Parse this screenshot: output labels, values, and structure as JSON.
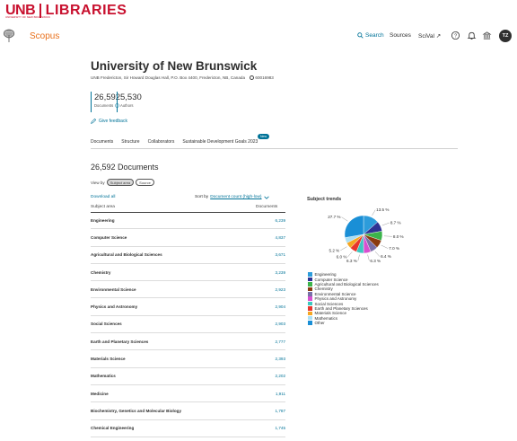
{
  "unb": {
    "mark": "UNB",
    "libraries": "LIBRARIES",
    "sub": "UNIVERSITY OF NEW BRUNSWICK"
  },
  "header": {
    "brand": "Scopus",
    "search_label": "Search",
    "sources_label": "Sources",
    "scival_label": "SciVal ↗",
    "avatar_initials": "TZ",
    "icons": [
      "search-icon",
      "help-icon",
      "bell-icon",
      "institution-icon"
    ]
  },
  "institution": {
    "name": "University of New Brunswick",
    "address": "UNB Fredericton, Sir Howard Douglas Hall, P.O. Box 4400, Fredericton, NB, Canada",
    "id": "60016983",
    "documents_count": "26,592",
    "documents_label": "Documents",
    "authors_count": "5,530",
    "authors_label": "Authors",
    "feedback_label": "Give feedback"
  },
  "tabs": [
    {
      "label": "Documents",
      "active": true
    },
    {
      "label": "Structure",
      "active": false
    },
    {
      "label": "Collaborators",
      "active": false
    },
    {
      "label": "Sustainable Development Goals 2023",
      "active": false
    }
  ],
  "new_badge": "New",
  "documents": {
    "heading": "26,592 Documents",
    "view_by_label": "View by",
    "view_options": [
      {
        "label": "Subject area",
        "selected": true
      },
      {
        "label": "Source",
        "selected": false
      }
    ],
    "download_label": "Download all",
    "sort_label": "Sort by",
    "sort_value": "Document count (high-low)",
    "col_subject": "Subject area",
    "col_docs": "Documents",
    "rows": [
      {
        "subject": "Engineering",
        "count": "6,239"
      },
      {
        "subject": "Computer Science",
        "count": "4,837"
      },
      {
        "subject": "Agricultural and Biological Sciences",
        "count": "3,671"
      },
      {
        "subject": "Chemistry",
        "count": "3,239"
      },
      {
        "subject": "Environmental Science",
        "count": "2,923"
      },
      {
        "subject": "Physics and Astronomy",
        "count": "2,904"
      },
      {
        "subject": "Social Sciences",
        "count": "2,903"
      },
      {
        "subject": "Earth and Planetary Sciences",
        "count": "2,777"
      },
      {
        "subject": "Materials Science",
        "count": "2,393"
      },
      {
        "subject": "Mathematics",
        "count": "2,202"
      },
      {
        "subject": "Medicine",
        "count": "1,911"
      },
      {
        "subject": "Biochemistry, Genetics and Molecular Biology",
        "count": "1,787"
      },
      {
        "subject": "Chemical Engineering",
        "count": "1,745"
      }
    ]
  },
  "trends": {
    "title": "Subject trends",
    "legend": [
      {
        "label": "Engineering",
        "color": "#2d9cdb"
      },
      {
        "label": "Computer Science",
        "color": "#2e3192"
      },
      {
        "label": "Agricultural and Biological Sciences",
        "color": "#3cb44b"
      },
      {
        "label": "Chemistry",
        "color": "#8b3a0f"
      },
      {
        "label": "Environmental Science",
        "color": "#7a6fa8"
      },
      {
        "label": "Physics and Astronomy",
        "color": "#d84fd0"
      },
      {
        "label": "Social Sciences",
        "color": "#3ec7c0"
      },
      {
        "label": "Earth and Planetary Sciences",
        "color": "#e8362d"
      },
      {
        "label": "Materials Science",
        "color": "#f5a623"
      },
      {
        "label": "Mathematics",
        "color": "#a9dff5"
      },
      {
        "label": "Other",
        "color": "#1a8fd6"
      }
    ]
  },
  "chart_data": {
    "type": "pie",
    "title": "Subject trends",
    "categories": [
      "Engineering",
      "Computer Science",
      "Agricultural and Biological Sciences",
      "Chemistry",
      "Environmental Science",
      "Physics and Astronomy",
      "Social Sciences",
      "Earth and Planetary Sciences",
      "Materials Science",
      "Mathematics",
      "Other"
    ],
    "values": [
      13.5,
      8.7,
      8.0,
      7.0,
      6.4,
      6.3,
      6.3,
      6.0,
      5.2,
      4.8,
      27.7
    ],
    "labels": [
      "13.5 %",
      "8.7 %",
      "8.0 %",
      "7.0 %",
      "6.4 %",
      "6.3 %",
      "6.3 %",
      "6.0 %",
      "5.2 %",
      "",
      "27.7 %"
    ],
    "colors": [
      "#2d9cdb",
      "#2e3192",
      "#3cb44b",
      "#8b3a0f",
      "#7a6fa8",
      "#d84fd0",
      "#3ec7c0",
      "#e8362d",
      "#f5a623",
      "#a9dff5",
      "#1a8fd6"
    ],
    "legend_position": "bottom"
  }
}
